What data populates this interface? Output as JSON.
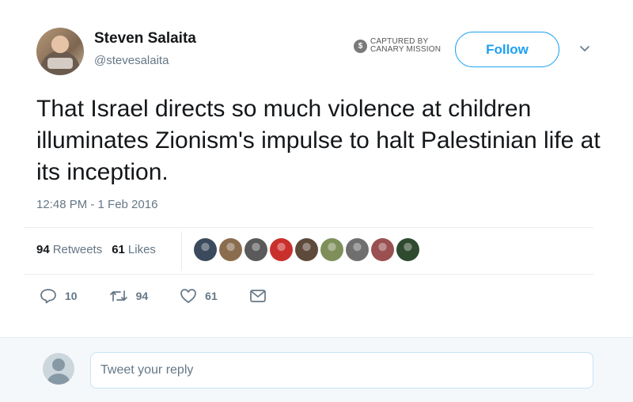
{
  "author": {
    "display_name": "Steven Salaita",
    "handle": "@stevesalaita",
    "avatar": "profile-photo"
  },
  "watermark": {
    "icon": "dollar-badge-icon",
    "icon_glyph": "$",
    "line1": "CAPTURED BY",
    "line2": "CANARY MISSION"
  },
  "follow_button": {
    "label": "Follow"
  },
  "menu": {
    "icon": "chevron-down-icon"
  },
  "tweet": {
    "text": "That Israel directs so much violence at children illuminates Zionism's impulse to halt Palestinian life at its inception.",
    "timestamp": "12:48 PM - 1 Feb 2016"
  },
  "stats": {
    "retweets_count": "94",
    "retweets_label": "Retweets",
    "likes_count": "61",
    "likes_label": "Likes"
  },
  "facepile_colors": [
    "#3b4a5c",
    "#8a6d4e",
    "#5a5a5a",
    "#c9302c",
    "#5e4a3a",
    "#7e8f5a",
    "#6f6f6f",
    "#9a5050",
    "#2f4a2f"
  ],
  "actions": {
    "reply": {
      "icon": "reply-icon",
      "count": "10"
    },
    "retweet": {
      "icon": "retweet-icon",
      "count": "94"
    },
    "like": {
      "icon": "heart-icon",
      "count": "61"
    },
    "dm": {
      "icon": "envelope-icon"
    }
  },
  "reply_box": {
    "placeholder": "Tweet your reply"
  },
  "colors": {
    "accent": "#1da1f2",
    "secondary_text": "#657786",
    "primary_text": "#14171a"
  }
}
